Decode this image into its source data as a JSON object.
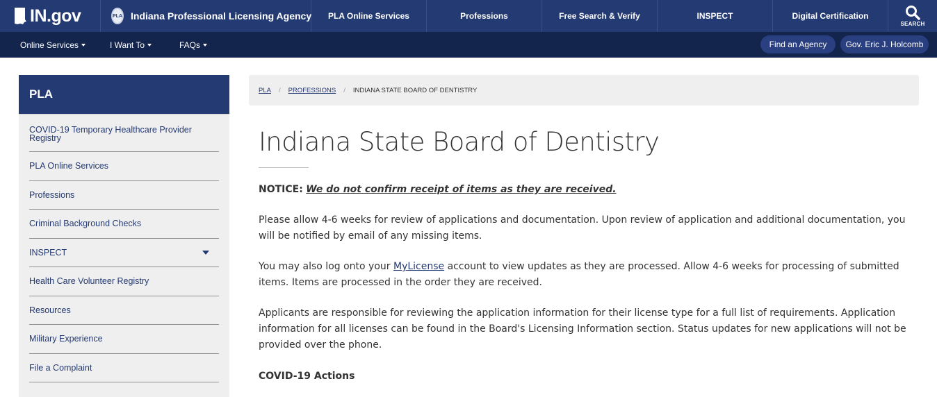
{
  "header": {
    "logo": {
      "text": "IN.gov",
      "icon": "indiana-state-icon"
    },
    "agency": {
      "seal_text": "PLA",
      "name": "Indiana Professional Licensing Agency"
    },
    "nav": [
      "PLA Online Services",
      "Professions",
      "Free Search & Verify",
      "INSPECT",
      "Digital Certification"
    ],
    "search_label": "SEARCH"
  },
  "subnav": {
    "items": [
      "Online Services",
      "I Want To",
      "FAQs"
    ],
    "find_agency": "Find an Agency",
    "governor": "Gov. Eric J. Holcomb"
  },
  "sidebar": {
    "title": "PLA",
    "items": [
      "COVID-19 Temporary Healthcare Provider Registry",
      "PLA Online Services",
      "Professions",
      "Criminal Background Checks",
      "INSPECT",
      "Health Care Volunteer Registry",
      "Resources",
      "Military Experience",
      "File a Complaint"
    ]
  },
  "breadcrumb": {
    "items": [
      "PLA",
      "PROFESSIONS",
      "INDIANA STATE BOARD OF DENTISTRY"
    ],
    "separator": "/"
  },
  "main": {
    "title": "Indiana State Board of Dentistry",
    "notice_label": "NOTICE:",
    "notice_text": "We do not confirm receipt of items as they are received.",
    "p1": "Please allow 4-6 weeks for review of applications and documentation. Upon review of application and additional documentation, you will be notified by email of any missing items.",
    "p2_before": "You may also log onto your ",
    "p2_link": "MyLicense",
    "p2_after": " account to view updates as they are processed. Allow 4-6 weeks for processing of submitted items. Items are processed in the order they are received.",
    "p3": "Applicants are responsible for reviewing the application information for their license type for a full list of requirements. Application information for all licenses can be found in the Board's Licensing Information section.  Status updates for new applications will not be provided over the phone.",
    "covid_heading": "COVID-19 Actions"
  },
  "colors": {
    "brand_blue": "#243a73",
    "sub_bar": "#14254d",
    "panel_gray": "#efefef"
  }
}
